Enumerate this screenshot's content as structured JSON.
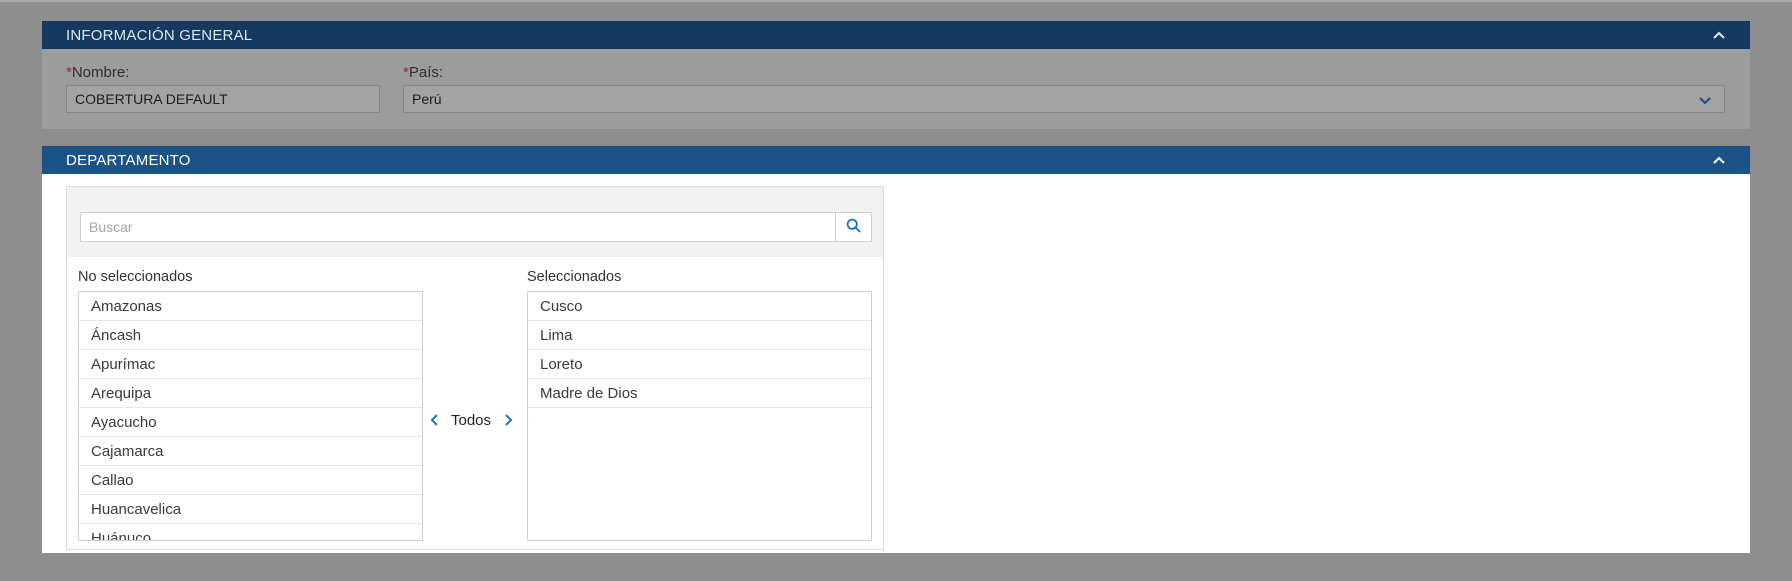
{
  "general": {
    "header": "INFORMACIÓN GENERAL",
    "name_label": "Nombre:",
    "name_value": "COBERTURA DEFAULT",
    "country_label": "País:",
    "country_value": "Perú",
    "required_mark": "*"
  },
  "departamento": {
    "header": "DEPARTAMENTO",
    "search_placeholder": "Buscar",
    "unselected_title": "No seleccionados",
    "selected_title": "Seleccionados",
    "transfer_label": "Todos",
    "unselected": [
      "Amazonas",
      "Áncash",
      "Apurímac",
      "Arequipa",
      "Ayacucho",
      "Cajamarca",
      "Callao",
      "Huancavelica",
      "Huánuco"
    ],
    "selected": [
      "Cusco",
      "Lima",
      "Loreto",
      "Madre de Dios"
    ]
  },
  "icons": {
    "collapse": "chevron-up-icon",
    "dropdown": "chevron-down-icon",
    "search": "search-icon",
    "move_left": "chevron-left-icon",
    "move_right": "chevron-right-icon"
  },
  "colors": {
    "header_general": "#153a5f",
    "header_dept": "#1d5286",
    "accent": "#1f6fc0",
    "required": "#b31d1d"
  }
}
